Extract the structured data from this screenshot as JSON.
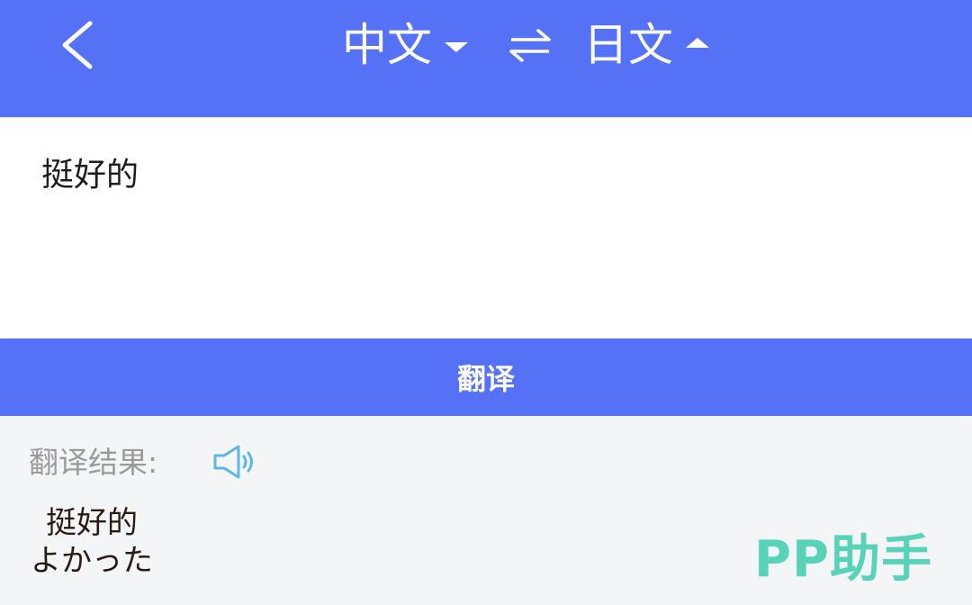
{
  "header": {
    "source_lang": "中文",
    "target_lang": "日文",
    "source_dropdown": "triangle-down-icon",
    "target_dropdown": "triangle-up-icon",
    "back_icon": "chevron-left-icon",
    "swap_icon": "swap-arrows-icon"
  },
  "input": {
    "text": "挺好的"
  },
  "translate_button": {
    "label": "翻译"
  },
  "result": {
    "label": "翻译结果:",
    "speaker_icon": "speaker-icon",
    "lines": [
      "挺好的",
      "よかった"
    ]
  },
  "watermark": {
    "text": "PP助手"
  },
  "colors": {
    "accent": "#5572f6",
    "background": "#f4f5f7",
    "speaker": "#5bb8e6",
    "watermark": "#4fd3b4"
  }
}
